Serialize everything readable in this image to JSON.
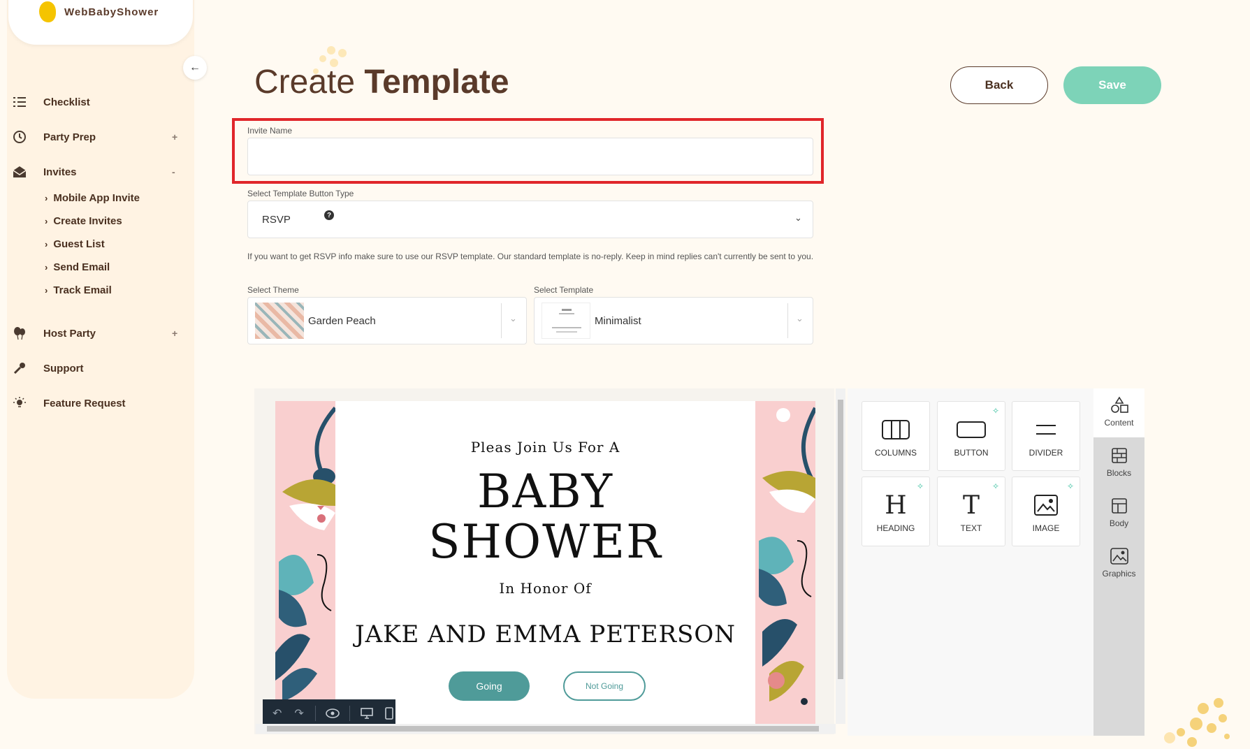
{
  "brand": {
    "name": "WebBabyShower"
  },
  "sidebar": {
    "items": [
      {
        "label": "Checklist",
        "icon": "checklist-icon",
        "toggle": ""
      },
      {
        "label": "Party Prep",
        "icon": "history-icon",
        "toggle": "+"
      },
      {
        "label": "Invites",
        "icon": "envelope-icon",
        "toggle": "-"
      },
      {
        "label": "Host Party",
        "icon": "balloons-icon",
        "toggle": "+"
      },
      {
        "label": "Support",
        "icon": "wrench-icon",
        "toggle": ""
      },
      {
        "label": "Feature Request",
        "icon": "lightbulb-icon",
        "toggle": ""
      }
    ],
    "invites_sub": [
      "Mobile App Invite",
      "Create Invites",
      "Guest List",
      "Send Email",
      "Track Email"
    ]
  },
  "header": {
    "title_light": "Create",
    "title_bold": "Template",
    "back_label": "Back",
    "save_label": "Save"
  },
  "form": {
    "invite_name_label": "Invite Name",
    "invite_name_value": "",
    "button_type_label": "Select Template Button Type",
    "button_type_value": "RSVP",
    "note": "If you want to get RSVP info make sure to use our RSVP template. Our standard template is no-reply. Keep in mind replies can't currently be sent to you.",
    "theme_label": "Select Theme",
    "theme_value": "Garden Peach",
    "template_label": "Select Template",
    "template_value": "Minimalist"
  },
  "invitation": {
    "line1": "Pleas Join Us For A",
    "line2": "BABY",
    "line3": "SHOWER",
    "line4": "In Honor Of",
    "names": "JAKE AND EMMA PETERSON",
    "going": "Going",
    "not_going": "Not Going"
  },
  "tools": [
    {
      "label": "COLUMNS",
      "icon": "columns-icon"
    },
    {
      "label": "BUTTON",
      "icon": "button-icon"
    },
    {
      "label": "DIVIDER",
      "icon": "divider-icon"
    },
    {
      "label": "HEADING",
      "icon": "heading-icon"
    },
    {
      "label": "TEXT",
      "icon": "text-icon"
    },
    {
      "label": "IMAGE",
      "icon": "image-icon"
    }
  ],
  "side_tabs": [
    "Content",
    "Blocks",
    "Body",
    "Graphics"
  ],
  "colors": {
    "accent": "#7dd3b8",
    "going": "#4f9b99",
    "highlight": "#e0262b",
    "sidebar_bg": "#fff3e3"
  }
}
